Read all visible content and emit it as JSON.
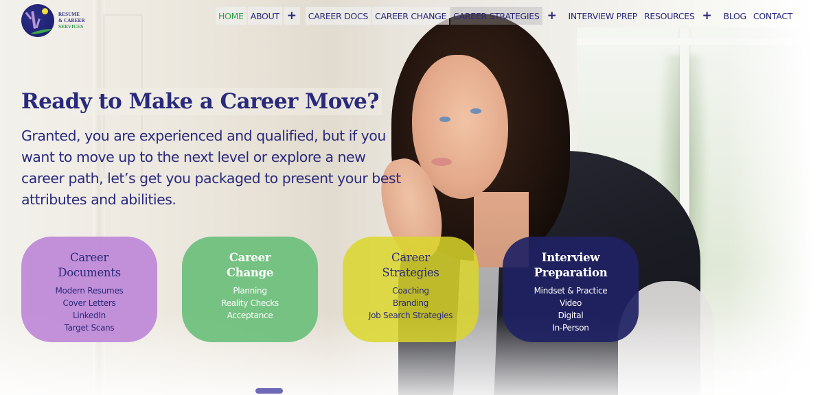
{
  "brand": {
    "logo_lines": [
      "RESUME",
      "& CAREER",
      "SERVICES"
    ],
    "colors": {
      "navy": "#2a2a7c",
      "green": "#2fa24c",
      "purple_card": "#bb83d6",
      "green_card": "#6bbf7b",
      "yellow_card": "#dad62c",
      "navy_card": "#202264"
    }
  },
  "nav": {
    "items": [
      {
        "label": "HOME",
        "active": true
      },
      {
        "label": "ABOUT"
      },
      {
        "label": "+",
        "type": "expand"
      },
      {
        "label": "CAREER DOCS"
      },
      {
        "label": "CAREER CHANGE"
      },
      {
        "label": "CAREER STRATEGIES"
      },
      {
        "label": "+",
        "type": "expand"
      },
      {
        "label": "INTERVIEW PREP"
      },
      {
        "label": "RESOURCES"
      },
      {
        "label": "+",
        "type": "expand"
      },
      {
        "label": "BLOG"
      },
      {
        "label": "CONTACT"
      }
    ]
  },
  "hero": {
    "title": "Ready to Make a Career Move?",
    "body": "Granted, you are experienced and qualified, but if you want to move up to the next level or explore a new career path, let’s get you packaged to present your best attributes and abilities."
  },
  "cards": [
    {
      "title_lines": [
        "Career",
        "Documents"
      ],
      "items": [
        "Modern Resumes",
        "Cover Letters",
        "LinkedIn",
        "Target Scans"
      ]
    },
    {
      "title_lines": [
        "Career",
        "Change"
      ],
      "items": [
        "Planning",
        "Reality Checks",
        "Acceptance"
      ]
    },
    {
      "title_lines": [
        "Career",
        "Strategies"
      ],
      "items": [
        "Coaching",
        "Branding",
        "Job Search Strategies"
      ]
    },
    {
      "title_lines": [
        "Interview",
        "Preparation"
      ],
      "items": [
        "Mindset & Practice",
        "Video",
        "Digital",
        "In-Person"
      ]
    }
  ]
}
